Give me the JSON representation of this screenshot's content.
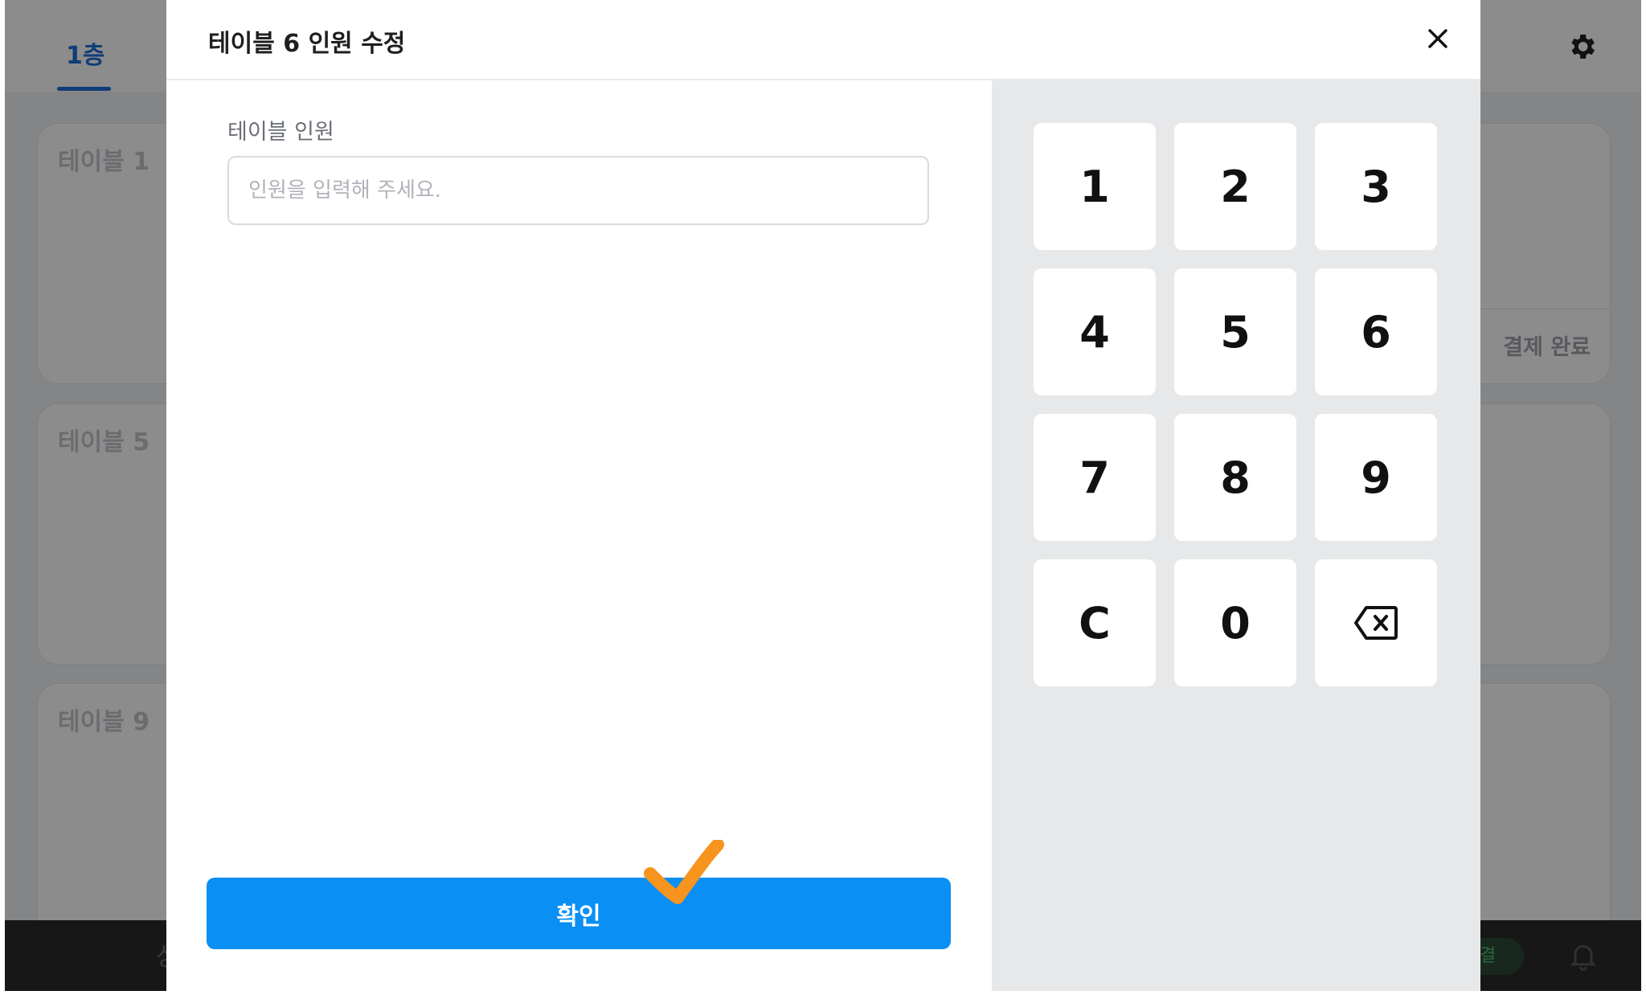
{
  "background": {
    "floor_tab": "1층",
    "tables": [
      {
        "title": "테이블 1"
      },
      {
        "title": "",
        "status": "결제 완료"
      },
      {
        "title": "테이블 5"
      },
      {
        "title": "테이블 9"
      }
    ],
    "bottom_bar": {
      "left_text": "상",
      "connect_label": "연결"
    }
  },
  "modal": {
    "title": "테이블 6 인원 수정",
    "field_label": "테이블 인원",
    "input_value": "",
    "input_placeholder": "인원을 입력해 주세요.",
    "confirm_label": "확인",
    "keypad": [
      "1",
      "2",
      "3",
      "4",
      "5",
      "6",
      "7",
      "8",
      "9",
      "C",
      "0",
      "backspace"
    ]
  },
  "colors": {
    "primary": "#0a8ff5",
    "accent_check": "#f7941d",
    "keypad_bg": "#e7e8ea"
  }
}
